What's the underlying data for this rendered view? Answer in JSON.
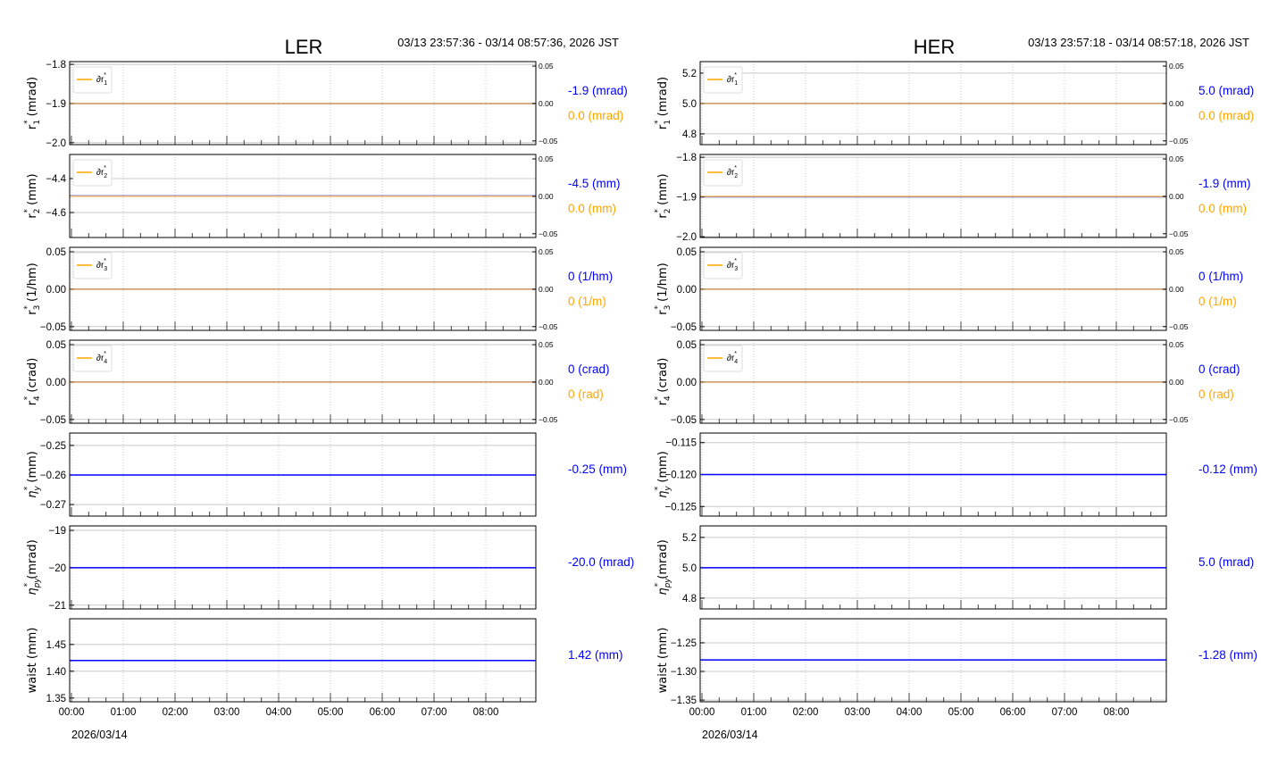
{
  "colors": {
    "main": "#0000ff",
    "delta": "#ffa500",
    "grid": "#c8c8c8",
    "axis": "#000000"
  },
  "chart_data": [
    {
      "type": "line",
      "title": "LER",
      "time_range": "03/13 23:57:36 - 03/14 08:57:36, 2026 JST",
      "date_label": "2026/03/14",
      "x_ticks": [
        "00:00",
        "01:00",
        "02:00",
        "03:00",
        "04:00",
        "05:00",
        "06:00",
        "07:00",
        "08:00"
      ],
      "xlim_hours": [
        0,
        8.97
      ],
      "panels": [
        {
          "sym": "r",
          "sub": "1",
          "unit": "(mrad)",
          "ylim": [
            -2.005,
            -1.793
          ],
          "yticks": [
            "-1.8",
            "-1.9",
            "-2.0"
          ],
          "ytick_values": [
            -1.8,
            -1.9,
            -2.0
          ],
          "value": -1.9,
          "value_label": "-1.9 (mrad)",
          "delta": {
            "legend_sub": "1",
            "ylim": [
              -0.055,
              0.056
            ],
            "yticks": [
              "0.05",
              "0.00",
              "-0.05"
            ],
            "ytick_values": [
              0.05,
              0,
              -0.05
            ],
            "value": 0,
            "value_label": "0.0 (mrad)"
          }
        },
        {
          "sym": "r",
          "sub": "2",
          "unit": "(mm)",
          "ylim": [
            -4.747,
            -4.258
          ],
          "yticks": [
            "-4.4",
            "-4.6"
          ],
          "ytick_values": [
            -4.4,
            -4.6
          ],
          "value": -4.5,
          "value_label": "-4.5 (mm)",
          "delta": {
            "legend_sub": "2",
            "ylim": [
              -0.055,
              0.056
            ],
            "yticks": [
              "0.05",
              "0.00",
              "-0.05"
            ],
            "ytick_values": [
              0.05,
              0,
              -0.05
            ],
            "value": 0,
            "value_label": "0.0 (mm)"
          }
        },
        {
          "sym": "r",
          "sub": "3",
          "unit": "(1/hm)",
          "ylim": [
            -0.055,
            0.056
          ],
          "yticks": [
            "0.05",
            "0.00",
            "-0.05"
          ],
          "ytick_values": [
            0.05,
            0,
            -0.05
          ],
          "value": 0,
          "value_label": "0 (1/hm)",
          "delta": {
            "legend_sub": "3",
            "ylim": [
              -0.055,
              0.056
            ],
            "yticks": [
              "0.05",
              "0.00",
              "-0.05"
            ],
            "ytick_values": [
              0.05,
              0,
              -0.05
            ],
            "value": 0,
            "value_label": "0 (1/m)"
          }
        },
        {
          "sym": "r",
          "sub": "4",
          "unit": "(crad)",
          "ylim": [
            -0.055,
            0.056
          ],
          "yticks": [
            "0.05",
            "0.00",
            "-0.05"
          ],
          "ytick_values": [
            0.05,
            0,
            -0.05
          ],
          "value": 0,
          "value_label": "0 (crad)",
          "delta": {
            "legend_sub": "4",
            "ylim": [
              -0.055,
              0.056
            ],
            "yticks": [
              "0.05",
              "0.00",
              "-0.05"
            ],
            "ytick_values": [
              0.05,
              0,
              -0.05
            ],
            "value": 0,
            "value_label": "0 (rad)"
          }
        },
        {
          "sym": "η",
          "sub": "y",
          "unit": "(mm)",
          "ylim": [
            -0.2739,
            -0.2458
          ],
          "yticks": [
            "-0.25",
            "-0.26",
            "-0.27"
          ],
          "ytick_values": [
            -0.25,
            -0.26,
            -0.27
          ],
          "value": -0.26,
          "value_label": "-0.25 (mm)"
        },
        {
          "sym": "η",
          "sub": "py",
          "unit": "(mrad)",
          "ylim": [
            -21.1,
            -18.88
          ],
          "yticks": [
            "-19",
            "-20",
            "-21"
          ],
          "ytick_values": [
            -19,
            -20,
            -21
          ],
          "value": -20,
          "value_label": "-20.0 (mrad)"
        },
        {
          "sym": "waist",
          "sub": "",
          "unit": "(mm)",
          "ylim": [
            1.343,
            1.498
          ],
          "yticks": [
            "1.45",
            "1.40",
            "1.35"
          ],
          "ytick_values": [
            1.45,
            1.4,
            1.35
          ],
          "value": 1.42,
          "value_label": "1.42 (mm)"
        }
      ]
    },
    {
      "type": "line",
      "title": "HER",
      "time_range": "03/13 23:57:18 - 03/14 08:57:18, 2026 JST",
      "date_label": "2026/03/14",
      "x_ticks": [
        "00:00",
        "01:00",
        "02:00",
        "03:00",
        "04:00",
        "05:00",
        "06:00",
        "07:00",
        "08:00"
      ],
      "xlim_hours": [
        0,
        8.97
      ],
      "panels": [
        {
          "sym": "r",
          "sub": "1",
          "unit": "(mrad)",
          "ylim": [
            4.729,
            5.276
          ],
          "yticks": [
            "5.2",
            "5.0",
            "4.8"
          ],
          "ytick_values": [
            5.2,
            5.0,
            4.8
          ],
          "value": 5.0,
          "value_label": "5.0 (mrad)",
          "delta": {
            "legend_sub": "1",
            "ylim": [
              -0.055,
              0.056
            ],
            "yticks": [
              "0.05",
              "0.00",
              "-0.05"
            ],
            "ytick_values": [
              0.05,
              0,
              -0.05
            ],
            "value": 0,
            "value_label": "0.0 (mrad)"
          }
        },
        {
          "sym": "r",
          "sub": "2",
          "unit": "(mm)",
          "ylim": [
            -2.002,
            -1.793
          ],
          "yticks": [
            "-1.8",
            "-1.9",
            "-2.0"
          ],
          "ytick_values": [
            -1.8,
            -1.9,
            -2.0
          ],
          "value": -1.9,
          "value_label": "-1.9 (mm)",
          "delta": {
            "legend_sub": "2",
            "ylim": [
              -0.055,
              0.056
            ],
            "yticks": [
              "0.05",
              "0.00",
              "-0.05"
            ],
            "ytick_values": [
              0.05,
              0,
              -0.05
            ],
            "value": 0,
            "value_label": "0.0 (mm)"
          }
        },
        {
          "sym": "r",
          "sub": "3",
          "unit": "(1/hm)",
          "ylim": [
            -0.055,
            0.056
          ],
          "yticks": [
            "0.05",
            "0.00",
            "-0.05"
          ],
          "ytick_values": [
            0.05,
            0,
            -0.05
          ],
          "value": 0,
          "value_label": "0 (1/hm)",
          "delta": {
            "legend_sub": "3",
            "ylim": [
              -0.055,
              0.056
            ],
            "yticks": [
              "0.05",
              "0.00",
              "-0.05"
            ],
            "ytick_values": [
              0.05,
              0,
              -0.05
            ],
            "value": 0,
            "value_label": "0 (1/m)"
          }
        },
        {
          "sym": "r",
          "sub": "4",
          "unit": "(crad)",
          "ylim": [
            -0.055,
            0.056
          ],
          "yticks": [
            "0.05",
            "0.00",
            "-0.05"
          ],
          "ytick_values": [
            0.05,
            0,
            -0.05
          ],
          "value": 0,
          "value_label": "0 (crad)",
          "delta": {
            "legend_sub": "4",
            "ylim": [
              -0.055,
              0.056
            ],
            "yticks": [
              "0.05",
              "0.00",
              "-0.05"
            ],
            "ytick_values": [
              0.05,
              0,
              -0.05
            ],
            "value": 0,
            "value_label": "0 (rad)"
          }
        },
        {
          "sym": "η",
          "sub": "y",
          "unit": "(mm)",
          "ylim": [
            -0.1265,
            -0.1135
          ],
          "yticks": [
            "-0.115",
            "-0.120",
            "-0.125"
          ],
          "ytick_values": [
            -0.115,
            -0.12,
            -0.125
          ],
          "value": -0.12,
          "value_label": "-0.12 (mm)"
        },
        {
          "sym": "η",
          "sub": "py",
          "unit": "(mrad)",
          "ylim": [
            4.729,
            5.276
          ],
          "yticks": [
            "5.2",
            "5.0",
            "4.8"
          ],
          "ytick_values": [
            5.2,
            5.0,
            4.8
          ],
          "value": 5.0,
          "value_label": "5.0 (mrad)"
        },
        {
          "sym": "waist",
          "sub": "",
          "unit": "(mm)",
          "ylim": [
            -1.353,
            -1.208
          ],
          "yticks": [
            "-1.25",
            "-1.30",
            "-1.35"
          ],
          "ytick_values": [
            -1.25,
            -1.3,
            -1.35
          ],
          "value": -1.28,
          "value_label": "-1.28 (mm)"
        }
      ]
    }
  ]
}
